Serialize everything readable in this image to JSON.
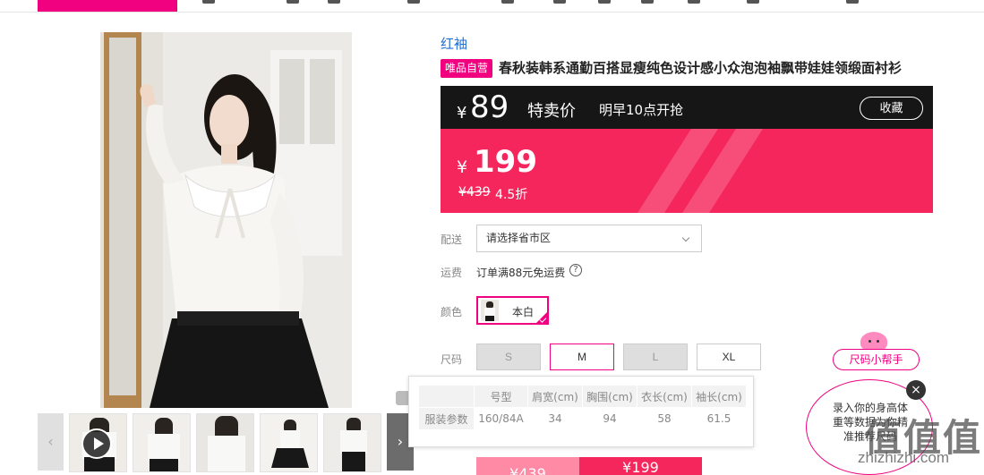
{
  "brand": "红袖",
  "badge": "唯品自营",
  "product_title": "春秋装韩系通勤百搭显瘦纯色设计感小众泡泡袖飘带娃娃领缎面衬衫",
  "special": {
    "currency": "¥",
    "price": "89",
    "label": "特卖价",
    "time": "明早10点开抢",
    "favorite_label": "收藏"
  },
  "price": {
    "currency": "¥",
    "current": "199",
    "original": "¥439",
    "discount": "4.5折"
  },
  "delivery": {
    "label": "配送",
    "placeholder": "请选择省市区"
  },
  "shipping": {
    "label": "运费",
    "text": "订单满88元免运费",
    "help": "?"
  },
  "color": {
    "label": "颜色",
    "option": "本白"
  },
  "size": {
    "label": "尺码",
    "options": [
      "S",
      "M",
      "L",
      "XL"
    ],
    "selected": "M"
  },
  "size_table": {
    "headers": [
      "",
      "号型",
      "肩宽(cm)",
      "胸围(cm)",
      "衣长(cm)",
      "袖长(cm)"
    ],
    "row": [
      "服装参数",
      "160/84A",
      "34",
      "94",
      "58",
      "61.5"
    ]
  },
  "buy": {
    "left": "¥439",
    "right": "¥199"
  },
  "thumbnails": {
    "prev": "‹",
    "next": "›"
  },
  "helper": {
    "button": "尺码小帮手",
    "text": "录入你的身高体重等数据为你精准推荐尺码",
    "close": "×"
  },
  "watermark": {
    "logo": "值值值",
    "url": "zhizhizhi.com"
  },
  "colors": {
    "accent": "#f10180",
    "price_bg": "#f5265b",
    "special_bg": "#161616"
  }
}
